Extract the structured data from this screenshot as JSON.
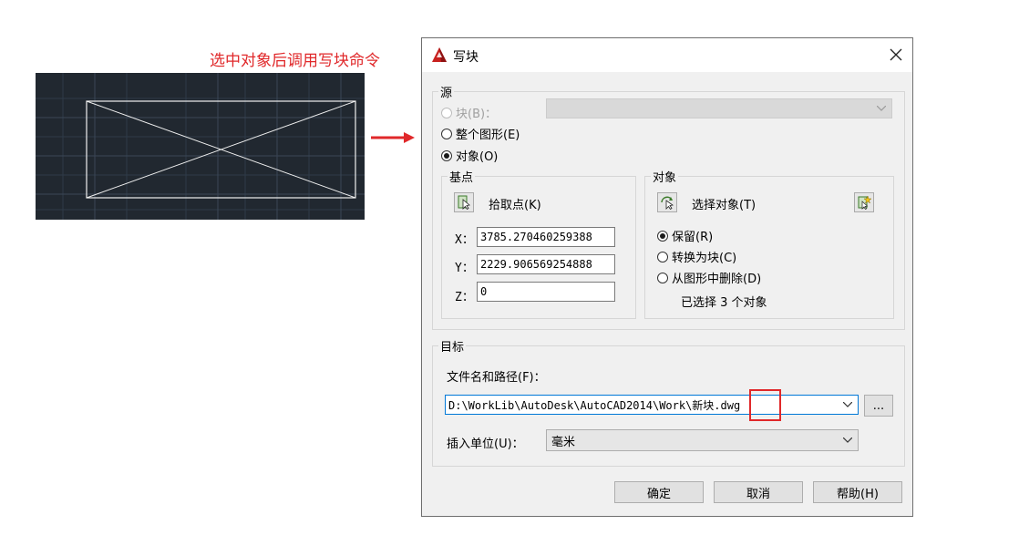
{
  "caption": "选中对象后调用写块命令",
  "dialog": {
    "title": "写块",
    "source": {
      "legend": "源",
      "block_label": "块(B)：",
      "whole_drawing_label": "整个图形(E)",
      "objects_label": "对象(O)",
      "selected": "objects"
    },
    "base_point": {
      "legend": "基点",
      "pick_label": "拾取点(K)",
      "x_label": "X：",
      "x_value": "3785.270460259388",
      "y_label": "Y：",
      "y_value": "2229.906569254888",
      "z_label": "Z：",
      "z_value": "0"
    },
    "objects": {
      "legend": "对象",
      "select_label": "选择对象(T)",
      "retain_label": "保留(R)",
      "convert_label": "转换为块(C)",
      "delete_label": "从图形中删除(D)",
      "selected": "retain",
      "status": "已选择 3 个对象"
    },
    "destination": {
      "legend": "目标",
      "path_label": "文件名和路径(F)：",
      "path_value": "D:\\WorkLib\\AutoDesk\\AutoCAD2014\\Work\\新块.dwg",
      "browse_label": "...",
      "units_label": "插入单位(U)：",
      "units_value": "毫米"
    },
    "buttons": {
      "ok": "确定",
      "cancel": "取消",
      "help": "帮助(H)"
    }
  },
  "colors": {
    "caption": "#e0282a",
    "canvas_bg": "#212830",
    "highlight": "#e0282a"
  },
  "icons": [
    "autocad-app-icon",
    "close-icon",
    "pick-point-icon",
    "select-objects-icon",
    "quick-select-icon",
    "chevron-down-icon",
    "red-arrow-icon"
  ]
}
